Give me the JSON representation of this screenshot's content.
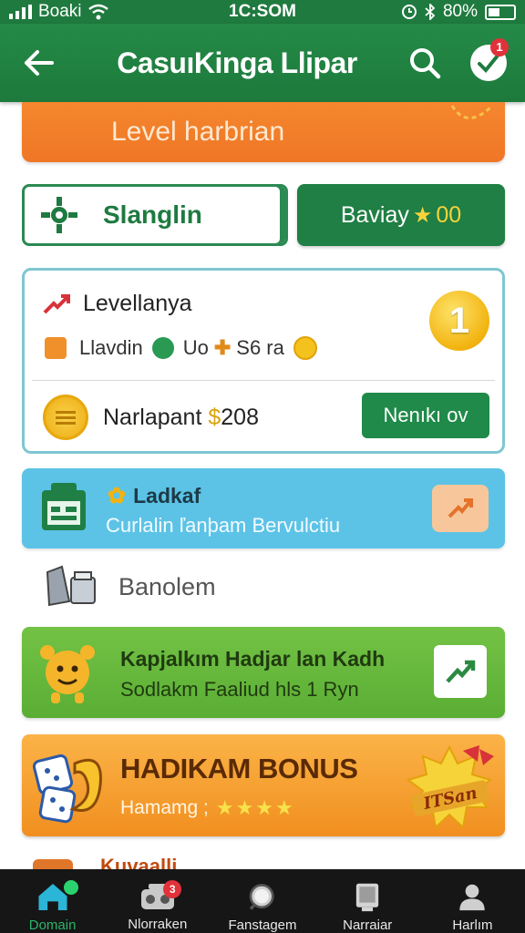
{
  "status_bar": {
    "carrier": "Boaki",
    "time": "1C:SOM",
    "battery": "80%"
  },
  "app_bar": {
    "title": "CasuıKinga Llipar",
    "notification_count": "1"
  },
  "level_banner": {
    "text": "Level harbrian"
  },
  "toggle": {
    "left_label": "Slanglin",
    "right_label": "Baviay",
    "right_value": "00"
  },
  "level_card": {
    "title": "Levellanya",
    "meta": {
      "a": "Llavdin",
      "b": "Uo",
      "c": "S6 ra"
    },
    "level_number": "1",
    "points_label": "Narlapant",
    "points_value": "208",
    "points_prefix": "$",
    "action_label": "Nenıkı ov"
  },
  "blue_card": {
    "title": "Ladkaf",
    "subtitle": "Curlalin ľanþam Bervulctiu"
  },
  "section": {
    "title": "Banolem"
  },
  "green_card": {
    "title": "Kapjalkım Hadjar lan Kadh",
    "subtitle": "Sodlakm Faaliud hls 1 Ryn"
  },
  "bonus_card": {
    "title": "HADIKAM BONUS",
    "subtitle": "Hamamg ;",
    "badge_text": "ITSan",
    "rating_stars": 4
  },
  "peek": {
    "text": "Kuvaalli"
  },
  "bottom_nav": {
    "items": [
      {
        "label": "Domain",
        "icon": "home-icon",
        "active": true
      },
      {
        "label": "Nlorraken",
        "icon": "radio-icon",
        "badge": "3"
      },
      {
        "label": "Fanstagem",
        "icon": "search-icon"
      },
      {
        "label": "Narraiar",
        "icon": "tablet-icon"
      },
      {
        "label": "Harlım",
        "icon": "profile-icon"
      }
    ]
  },
  "colors": {
    "primary": "#1f7a3f",
    "accent_orange": "#f5872e",
    "accent_blue": "#5cc3e6",
    "accent_green": "#5aae34",
    "gold": "#f2b30f"
  }
}
